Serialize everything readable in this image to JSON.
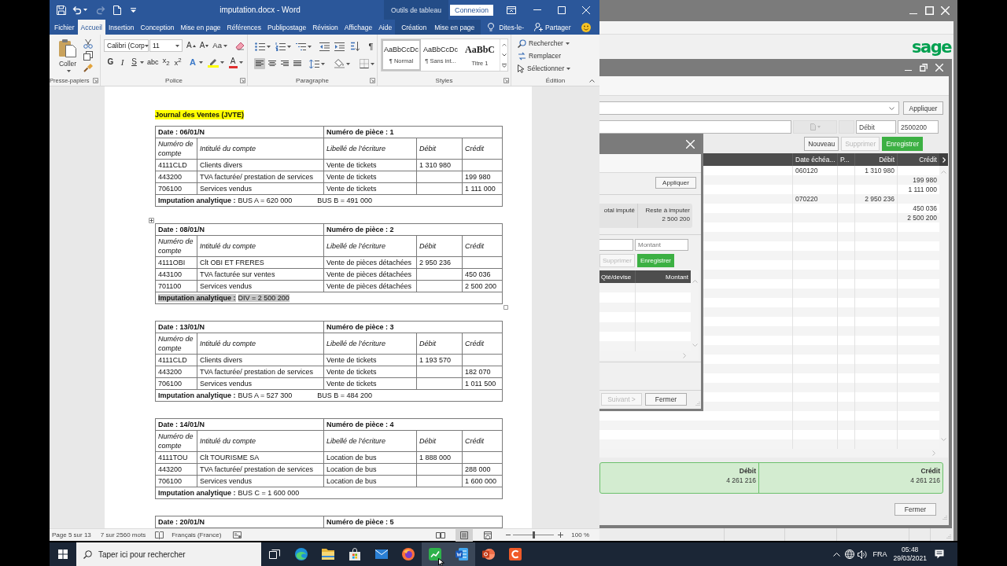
{
  "word": {
    "quick_access": [
      {
        "kind": "save",
        "disabled": false
      },
      {
        "kind": "undo",
        "disabled": false
      },
      {
        "kind": "redo",
        "disabled": true
      },
      {
        "kind": "new",
        "disabled": false
      },
      {
        "kind": "customize",
        "disabled": false
      }
    ],
    "title": "imputation.docx - Word",
    "contextual_label": "Outils de tableau",
    "sign_in": "Connexion",
    "tabs": [
      {
        "label": "Fichier",
        "selected": false,
        "contextual": false
      },
      {
        "label": "Accueil",
        "selected": true,
        "contextual": false
      },
      {
        "label": "Insertion",
        "selected": false,
        "contextual": false
      },
      {
        "label": "Conception",
        "selected": false,
        "contextual": false
      },
      {
        "label": "Mise en page",
        "selected": false,
        "contextual": false
      },
      {
        "label": "Références",
        "selected": false,
        "contextual": false
      },
      {
        "label": "Publipostage",
        "selected": false,
        "contextual": false
      },
      {
        "label": "Révision",
        "selected": false,
        "contextual": false
      },
      {
        "label": "Affichage",
        "selected": false,
        "contextual": false
      },
      {
        "label": "Aide",
        "selected": false,
        "contextual": false
      },
      {
        "label": "Création",
        "selected": false,
        "contextual": true
      },
      {
        "label": "Mise en page",
        "selected": false,
        "contextual": true
      }
    ],
    "tell_me": "Dites-le-",
    "share": "Partager",
    "ribbon": {
      "clipboard": {
        "paste": "Coller",
        "label": "Presse-papiers"
      },
      "font": {
        "name": "Calibri (Corp",
        "size": "11",
        "size_buttons": [
          {
            "kind": "grow",
            "glyph": "A"
          },
          {
            "kind": "shrink",
            "glyph": "A"
          }
        ],
        "case_button": "Aa",
        "format_buttons": [
          {
            "kind": "bold",
            "glyph": "G"
          },
          {
            "kind": "italic",
            "glyph": "I"
          },
          {
            "kind": "underline",
            "glyph": "S"
          },
          {
            "kind": "strike",
            "glyph": "abc"
          },
          {
            "kind": "subscript",
            "glyph": "x$_{2}$"
          },
          {
            "kind": "superscript",
            "glyph": "x$^{2}$"
          }
        ],
        "color_buttons": [
          {
            "kind": "effects",
            "glyph": "A"
          },
          {
            "kind": "highlight"
          },
          {
            "kind": "color",
            "glyph": "A"
          }
        ],
        "label": "Police"
      },
      "paragraph": {
        "alignments": [
          {
            "kind": "left",
            "selected": true
          },
          {
            "kind": "center",
            "selected": false
          },
          {
            "kind": "right",
            "selected": false
          },
          {
            "kind": "justify",
            "selected": false
          }
        ],
        "marks": "¶",
        "label": "Paragraphe"
      },
      "styles": {
        "items": [
          {
            "sample": "AaBbCcDc",
            "name": "¶ Normal",
            "selected": true,
            "kind": "body"
          },
          {
            "sample": "AaBbCcDc",
            "name": "¶ Sans int...",
            "selected": false,
            "kind": "body"
          },
          {
            "sample": "AaBbC",
            "name": "Titre 1",
            "selected": false,
            "kind": "heading"
          }
        ],
        "label": "Styles"
      },
      "editing": {
        "items": [
          {
            "kind": "find",
            "label": "Rechercher"
          },
          {
            "kind": "replace",
            "label": "Remplacer"
          },
          {
            "kind": "select",
            "label": "Sélectionner"
          }
        ],
        "label": "Édition"
      }
    },
    "document": {
      "heading": "Journal des Ventes (JVTE)",
      "tables": [
        {
          "date": "Date : 06/01/N",
          "piece": "Numéro de pièce : 1",
          "active": false,
          "columns": [
            "Numéro de compte",
            "Intitulé du compte",
            "Libellé de l’écriture",
            "Débit",
            "Crédit"
          ],
          "rows": [
            {
              "account": "4111CLD",
              "name": "Clients divers",
              "label": "Vente de tickets",
              "debit": "1 310 980"
            },
            {
              "account": "443200",
              "name": "TVA facturée/ prestation de services",
              "label": "Vente de tickets",
              "credit": "199 980"
            },
            {
              "account": "706100",
              "name": "Services vendus",
              "label": "Vente de tickets",
              "credit": "1 111 000"
            }
          ],
          "imputation": {
            "label": "Imputation analytique :",
            "amounts": [
              "BUS A = 620 000",
              "BUS B = 491 000"
            ],
            "selected": false
          }
        },
        {
          "date": "Date : 08/01/N",
          "piece": "Numéro de pièce : 2",
          "active": true,
          "columns": [
            "Numéro de compte",
            "Intitulé du compte",
            "Libellé de l’écriture",
            "Débit",
            "Crédit"
          ],
          "rows": [
            {
              "account": "4111OBI",
              "name": "Clt OBI ET FRERES",
              "label": "Vente de pièces détachées",
              "debit": "2 950 236"
            },
            {
              "account": "443100",
              "name": "TVA facturée sur ventes",
              "label": "Vente de pièces détachées",
              "credit": "450 036"
            },
            {
              "account": "701100",
              "name": "Services vendus",
              "label": "Vente de pièces détachées",
              "credit": "2 500 200"
            }
          ],
          "imputation": {
            "label": "Imputation analytique :",
            "amounts": [
              "DIV = 2 500 200"
            ],
            "selected": true
          }
        },
        {
          "date": "Date : 13/01/N",
          "piece": "Numéro de pièce : 3",
          "active": false,
          "columns": [
            "Numéro de compte",
            "Intitulé du compte",
            "Libellé de l’écriture",
            "Débit",
            "Crédit"
          ],
          "rows": [
            {
              "account": "4111CLD",
              "name": "Clients divers",
              "label": "Vente de tickets",
              "debit": "1 193 570"
            },
            {
              "account": "443200",
              "name": "TVA facturée/ prestation de services",
              "label": "Vente de tickets",
              "credit": "182 070"
            },
            {
              "account": "706100",
              "name": "Services vendus",
              "label": "Vente de tickets",
              "credit": "1 011 500"
            }
          ],
          "imputation": {
            "label": "Imputation analytique :",
            "amounts": [
              "BUS A = 527 300",
              "BUS B = 484 200"
            ],
            "selected": false
          }
        },
        {
          "date": "Date : 14/01/N",
          "piece": "Numéro de pièce : 4",
          "active": false,
          "columns": [
            "Numéro de compte",
            "Intitulé du compte",
            "Libellé de l’écriture",
            "Débit",
            "Crédit"
          ],
          "rows": [
            {
              "account": "4111TOU",
              "name": "Clt TOURISME SA",
              "label": "Location de bus",
              "debit": "1 888 000"
            },
            {
              "account": "443200",
              "name": "TVA facturée/ prestation de services",
              "label": "Location de bus",
              "credit": "288 000"
            },
            {
              "account": "706100",
              "name": "Services vendus",
              "label": "Location de bus",
              "credit": "1 600 000"
            }
          ],
          "imputation": {
            "label": "Imputation analytique :",
            "amounts": [
              "BUS C = 1 600 000"
            ],
            "selected": false
          }
        },
        {
          "date": "Date : 20/01/N",
          "piece": "Numéro de pièce : 5",
          "active": false
        }
      ]
    },
    "status_bar": {
      "page": "Page 5 sur 13",
      "words": "7 sur 2560 mots",
      "language": "Français (France)",
      "views": [
        {
          "kind": "read",
          "selected": false
        },
        {
          "kind": "print",
          "selected": true
        },
        {
          "kind": "web",
          "selected": false
        }
      ],
      "zoom": {
        "level": 0.5,
        "reading": "100 %"
      }
    }
  },
  "sage": {
    "logo": "sage",
    "filter_button": "Appliquer",
    "entry": {
      "sense": "Débit",
      "amount": "2500200"
    },
    "actions": [
      {
        "label": "Nouveau",
        "disabled": false,
        "kind": "new"
      },
      {
        "label": "Supprimer",
        "disabled": true,
        "kind": "delete"
      },
      {
        "label": "Enregistrer",
        "disabled": false,
        "kind": "save"
      }
    ],
    "grid": {
      "columns": [
        "Date échéa...",
        "P...",
        "Débit",
        "Crédit"
      ],
      "rows": [
        {
          "due_date": "060120",
          "debit": "1 310 980"
        },
        {
          "credit": "199 980"
        },
        {
          "credit": "1 111 000"
        },
        {
          "due_date": "070220",
          "debit": "2 950 236"
        },
        {
          "credit": "450 036"
        },
        {
          "credit": "2 500 200"
        }
      ]
    },
    "totals": [
      {
        "label": "Débit",
        "value": "4 261 216"
      },
      {
        "label": "Crédit",
        "value": "4 261 216"
      }
    ],
    "close_button": "Fermer",
    "dialog": {
      "apply_button": "Appliquer",
      "summary": [
        {
          "label": "otal imputé"
        },
        {
          "label": "Reste à imputer",
          "value": "2 500 200"
        }
      ],
      "amount_field": {
        "placeholder": "Montant"
      },
      "actions": [
        {
          "label": "Supprimer",
          "disabled": true,
          "kind": "delete"
        },
        {
          "label": "Enregistrer",
          "disabled": false,
          "kind": "save"
        }
      ],
      "columns": [
        "Qté/devise",
        "Montant"
      ],
      "buttons": [
        {
          "label": "Suivant >",
          "disabled": true
        },
        {
          "label": "Fermer",
          "disabled": false
        }
      ]
    }
  },
  "taskbar": {
    "search": {
      "placeholder": "Taper ici pour rechercher"
    },
    "apps": [
      {
        "kind": "edge",
        "active": false
      },
      {
        "kind": "explorer",
        "active": false
      },
      {
        "kind": "store",
        "active": false
      },
      {
        "kind": "mail",
        "active": false
      },
      {
        "kind": "firefox",
        "active": false
      },
      {
        "kind": "sage",
        "active": true
      },
      {
        "kind": "word",
        "active": true
      },
      {
        "kind": "powerpoint",
        "active": false
      },
      {
        "kind": "camtasia",
        "active": false
      }
    ],
    "tray": {
      "language": "FRA",
      "time": "05:48",
      "date": "29/03/2021"
    }
  }
}
